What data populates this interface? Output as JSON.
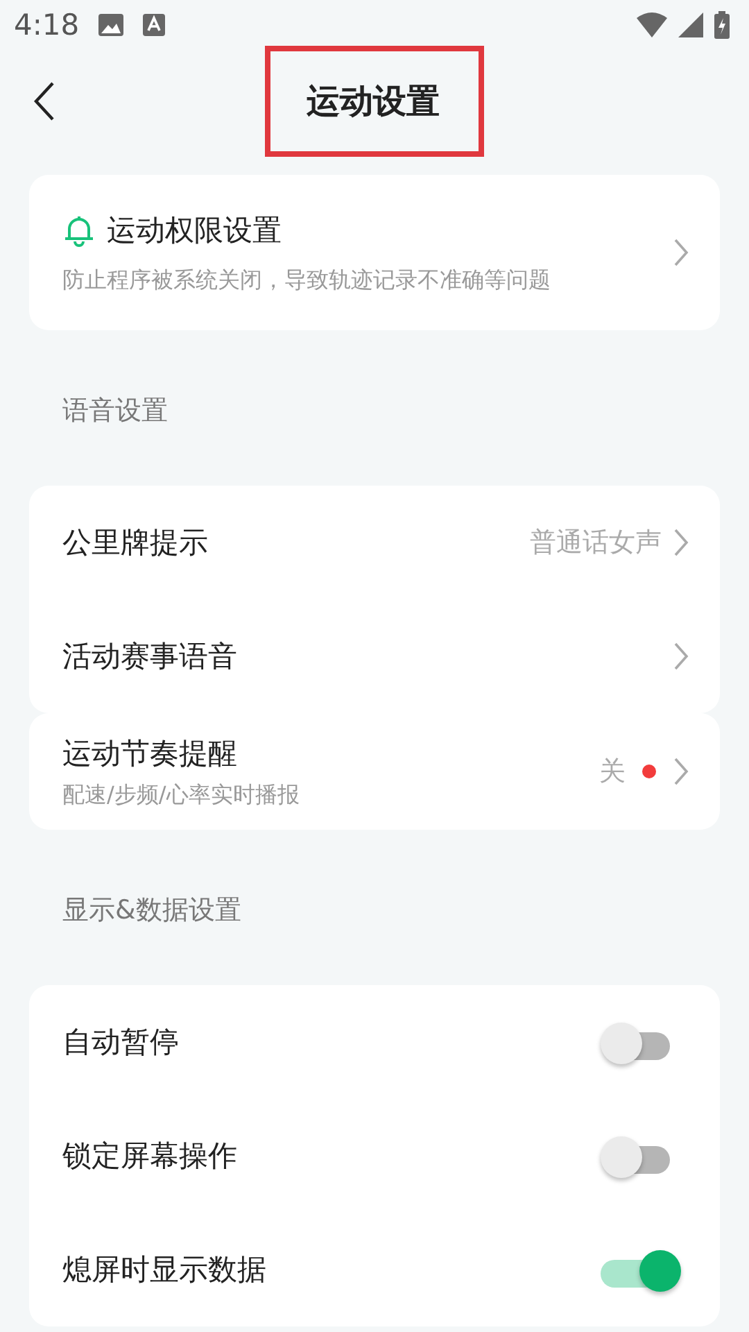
{
  "status_bar": {
    "time": "4:18"
  },
  "header": {
    "title": "运动设置",
    "highlighted": true
  },
  "groups": [
    {
      "rows": [
        {
          "kind": "link",
          "title": "运动权限设置",
          "subtitle": "防止程序被系统关闭，导致轨迹记录不准确等问题"
        }
      ]
    },
    {
      "label": "语音设置",
      "rows": [
        {
          "kind": "link",
          "title": "公里牌提示",
          "value": "普通话女声"
        },
        {
          "kind": "link",
          "title": "活动赛事语音"
        }
      ]
    },
    {
      "rows": [
        {
          "kind": "link",
          "title": "运动节奏提醒",
          "subtitle": "配速/步频/心率实时播报",
          "value": "关",
          "dot": true
        }
      ]
    },
    {
      "label": "显示&数据设置",
      "rows": [
        {
          "kind": "toggle",
          "title": "自动暂停",
          "on": false
        },
        {
          "kind": "toggle",
          "title": "锁定屏幕操作",
          "on": false
        },
        {
          "kind": "toggle",
          "title": "熄屏时显示数据",
          "on": true
        }
      ]
    }
  ]
}
